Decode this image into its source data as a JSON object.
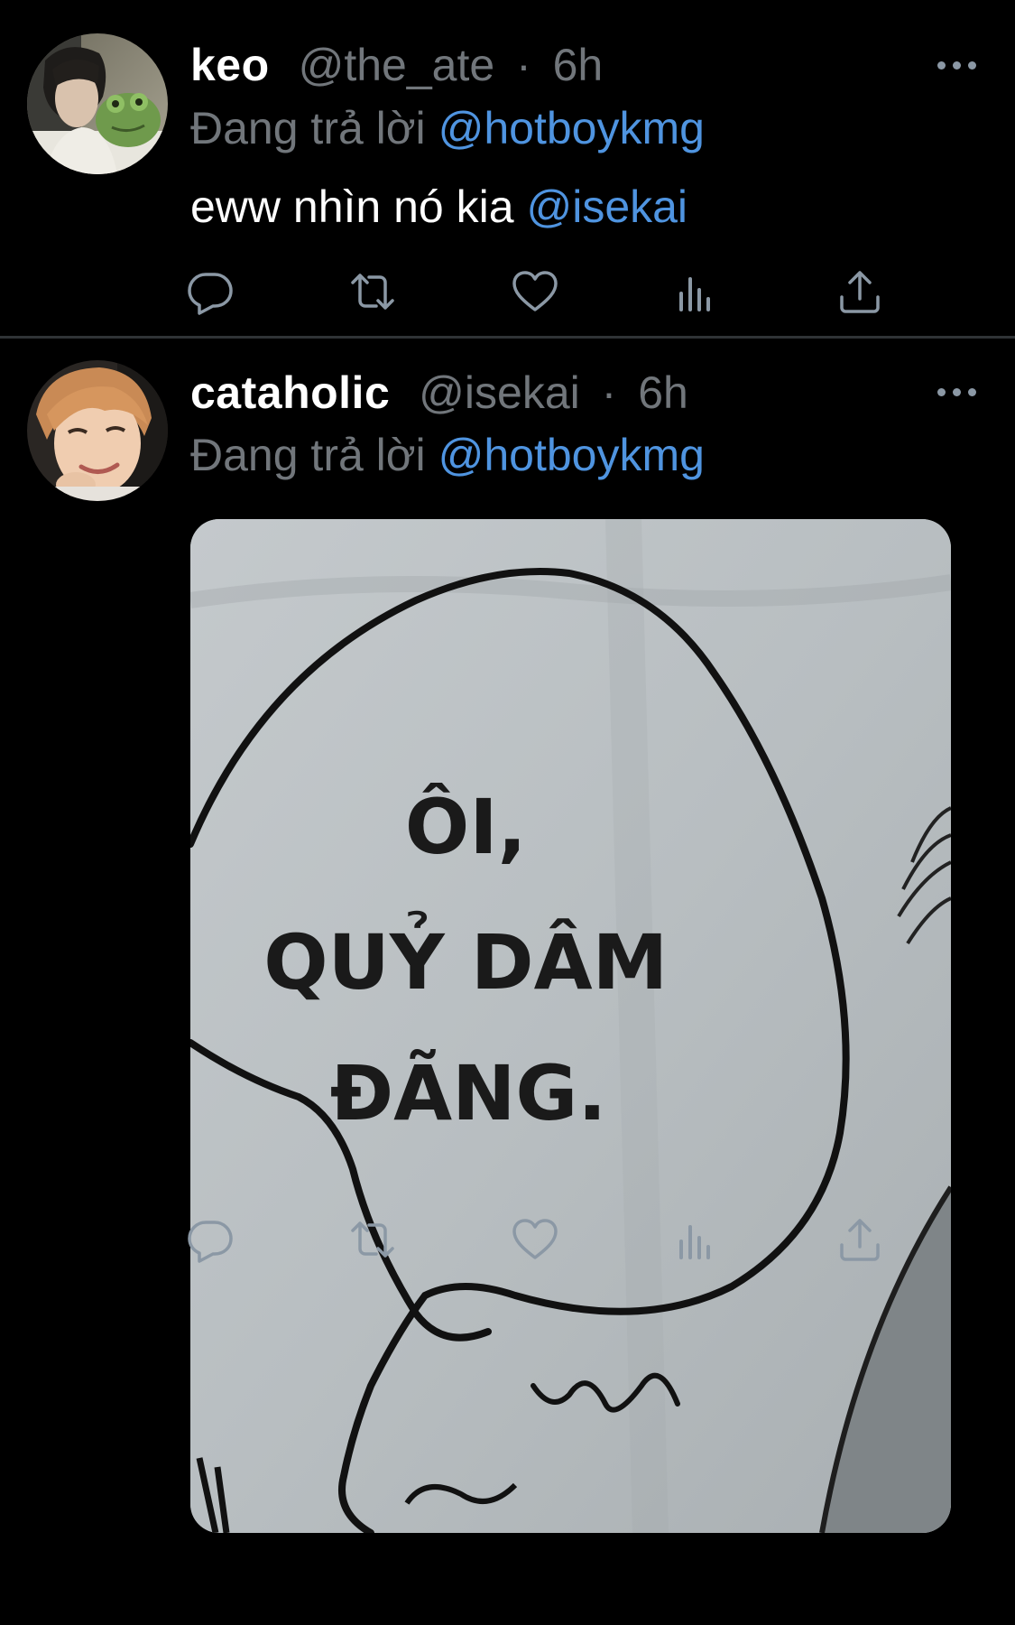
{
  "colors": {
    "background": "#000000",
    "name": "#ffffff",
    "secondary_text": "#71767b",
    "link": "#4f94e0",
    "divider": "#2f3336",
    "icon": "#8b98a5"
  },
  "tweets": [
    {
      "display_name": "keo",
      "handle": "@the_ate",
      "separator": "·",
      "time": "6h",
      "reply_prefix": "Đang trả lời",
      "reply_to": "@hotboykmg",
      "text": "eww nhìn nó kia",
      "text_mention": "@isekai",
      "actions": [
        "reply-icon",
        "retweet-icon",
        "like-icon",
        "views-icon",
        "share-icon"
      ]
    },
    {
      "display_name": "cataholic",
      "handle": "@isekai",
      "separator": "·",
      "time": "6h",
      "reply_prefix": "Đang trả lời",
      "reply_to": "@hotboykmg",
      "media": {
        "description": "manga-speech-bubble",
        "lines": [
          "ÔI,",
          "QUỶ DÂM",
          "ĐÃNG."
        ]
      },
      "actions": [
        "reply-icon",
        "retweet-icon",
        "like-icon",
        "views-icon",
        "share-icon"
      ]
    }
  ]
}
